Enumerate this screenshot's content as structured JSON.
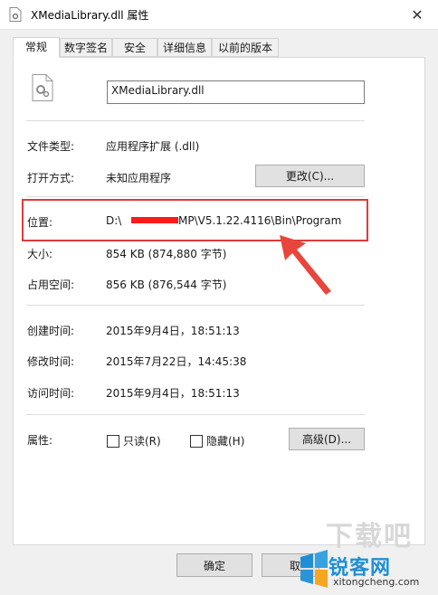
{
  "window": {
    "title": "XMediaLibrary.dll 属性",
    "close_glyph": "✕"
  },
  "tabs": [
    {
      "label": "常规"
    },
    {
      "label": "数字签名"
    },
    {
      "label": "安全"
    },
    {
      "label": "详细信息"
    },
    {
      "label": "以前的版本"
    }
  ],
  "general": {
    "filename": "XMediaLibrary.dll",
    "file_type_label": "文件类型:",
    "file_type_value": "应用程序扩展 (.dll)",
    "opens_with_label": "打开方式:",
    "opens_with_value": "未知应用程序",
    "change_button": "更改(C)...",
    "location_label": "位置:",
    "location_value_start": "D:\\",
    "location_value_end": "MP\\V5.1.22.4116\\Bin\\Program",
    "size_label": "大小:",
    "size_value": "854 KB (874,880 字节)",
    "size_on_disk_label": "占用空间:",
    "size_on_disk_value": "856 KB (876,544 字节)",
    "created_label": "创建时间:",
    "created_value": "2015年9月4日，18:51:13",
    "modified_label": "修改时间:",
    "modified_value": "2015年7月22日，14:45:38",
    "accessed_label": "访问时间:",
    "accessed_value": "2015年9月4日，18:51:13",
    "attributes_label": "属性:",
    "readonly_label": "只读(R)",
    "hidden_label": "隐藏(H)",
    "advanced_button": "高级(D)..."
  },
  "footer": {
    "ok_button": "确定",
    "cancel_button": "取"
  },
  "watermark": {
    "brand": "锐客网",
    "url": "xitongcheng.com",
    "faint": "下载吧"
  },
  "colors": {
    "highlight": "#e03a3a",
    "arrow": "#e8463c",
    "brand": "#1e8fd5"
  }
}
